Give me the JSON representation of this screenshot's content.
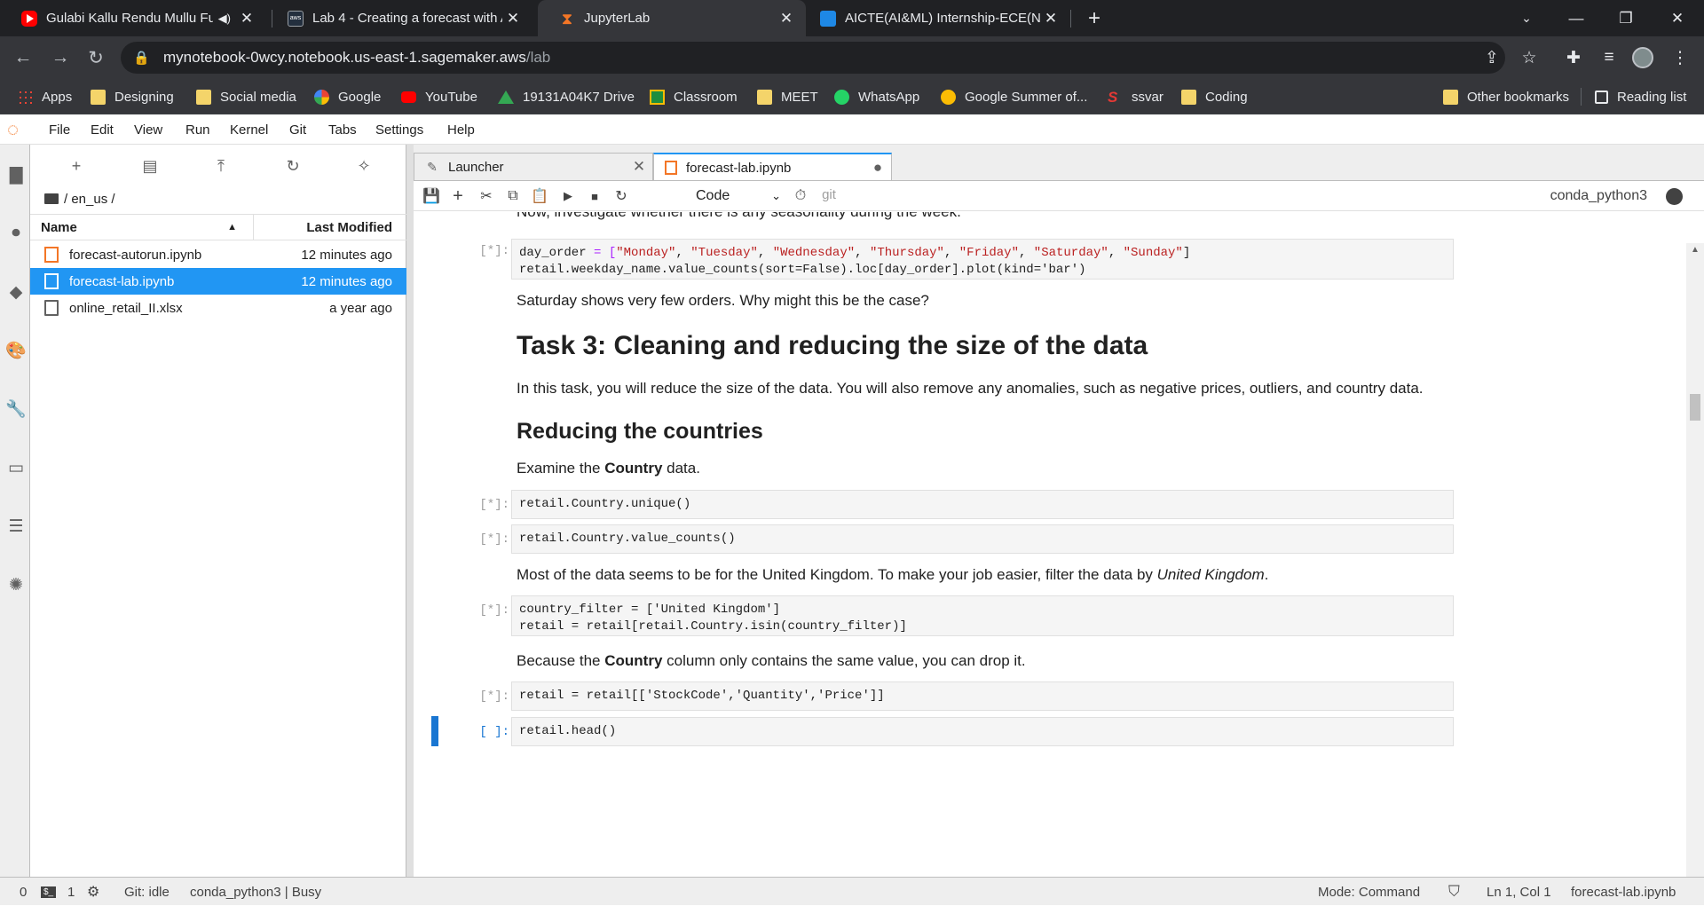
{
  "browser": {
    "tabs": [
      {
        "title": "Gulabi Kallu Rendu Mullu Fu",
        "icon": "youtube-icon",
        "extra": "audio-icon"
      },
      {
        "title": "Lab 4 - Creating a forecast with A",
        "icon": "aws-icon"
      },
      {
        "title": "JupyterLab",
        "icon": "jupyter-icon"
      },
      {
        "title": "AICTE(AI&ML) Internship-ECE(No",
        "icon": "classroom-icon"
      }
    ],
    "new_tab": "+",
    "address": {
      "host": "mynotebook-0wcy.notebook.us-east-1.sagemaker.aws",
      "path": "/lab"
    },
    "bookmarks": [
      {
        "label": "Apps",
        "icon": "apps-grid-icon"
      },
      {
        "label": "Designing",
        "icon": "folder-icon"
      },
      {
        "label": "Social media",
        "icon": "folder-icon"
      },
      {
        "label": "Google",
        "icon": "google-icon"
      },
      {
        "label": "YouTube",
        "icon": "youtube-icon"
      },
      {
        "label": "19131A04K7 Drive",
        "icon": "drive-icon"
      },
      {
        "label": "Classroom",
        "icon": "classroom-icon"
      },
      {
        "label": "MEET",
        "icon": "folder-icon"
      },
      {
        "label": "WhatsApp",
        "icon": "whatsapp-icon"
      },
      {
        "label": "Google Summer of...",
        "icon": "gsoc-icon"
      },
      {
        "label": "ssvar",
        "icon": "ssvar-icon"
      },
      {
        "label": "Coding",
        "icon": "folder-icon"
      }
    ],
    "other_bookmarks": "Other bookmarks",
    "reading_list": "Reading list"
  },
  "jupyter": {
    "menu": [
      "File",
      "Edit",
      "View",
      "Run",
      "Kernel",
      "Git",
      "Tabs",
      "Settings",
      "Help"
    ],
    "file_browser": {
      "breadcrumb": "/ en_us /",
      "col_name": "Name",
      "col_modified": "Last Modified",
      "files": [
        {
          "name": "forecast-autorun.ipynb",
          "modified": "12 minutes ago",
          "type": "notebook"
        },
        {
          "name": "forecast-lab.ipynb",
          "modified": "12 minutes ago",
          "type": "notebook",
          "selected": true
        },
        {
          "name": "online_retail_II.xlsx",
          "modified": "a year ago",
          "type": "file"
        }
      ]
    },
    "doc_tabs": [
      {
        "title": "Launcher"
      },
      {
        "title": "forecast-lab.ipynb"
      }
    ],
    "toolbar": {
      "cell_type": "Code",
      "git": "git",
      "kernel": "conda_python3"
    },
    "notebook": {
      "partial_text": "Now, investigate whether there is any seasonality during the week.",
      "saturday_text": "Saturday shows very few orders. Why might this be the case?",
      "task3_heading": "Task 3: Cleaning and reducing the size of the data",
      "task3_text": "In this task, you will reduce the size of the data. You will also remove any anomalies, such as negative prices, outliers, and country data.",
      "reduce_heading": "Reducing the countries",
      "examine_pre": "Examine the ",
      "examine_bold": "Country",
      "examine_post": " data.",
      "most_pre": "Most of the data seems to be for the United Kingdom. To make your job easier, filter the data by ",
      "most_italic": "United Kingdom",
      "most_post": ".",
      "because_pre": "Because the ",
      "because_bold": "Country",
      "because_post": " column only contains the same value, you can drop it.",
      "prompt_running": "[*]:",
      "prompt_empty": "[ ]:",
      "code": {
        "c1_l1_var": "day_order",
        "c1_l1_op": " = [",
        "c1_l1_days": [
          "\"Monday\"",
          "\"Tuesday\"",
          "\"Wednesday\"",
          "\"Thursday\"",
          "\"Friday\"",
          "\"Saturday\"",
          "\"Sunday\""
        ],
        "c1_l2": "retail.weekday_name.value_counts(sort=False).loc[day_order].plot(kind='bar')",
        "c2": "retail.Country.unique()",
        "c3": "retail.Country.value_counts()",
        "c4_l1": "country_filter = ['United Kingdom']",
        "c4_l2": "retail = retail[retail.Country.isin(country_filter)]",
        "c5": "retail = retail[['StockCode','Quantity','Price']]",
        "c6": "retail.head()"
      }
    },
    "status": {
      "count0": "0",
      "terminals": "1",
      "git": "Git: idle",
      "kernel": "conda_python3 | Busy",
      "mode": "Mode: Command",
      "position": "Ln 1, Col 1",
      "file": "forecast-lab.ipynb"
    }
  }
}
